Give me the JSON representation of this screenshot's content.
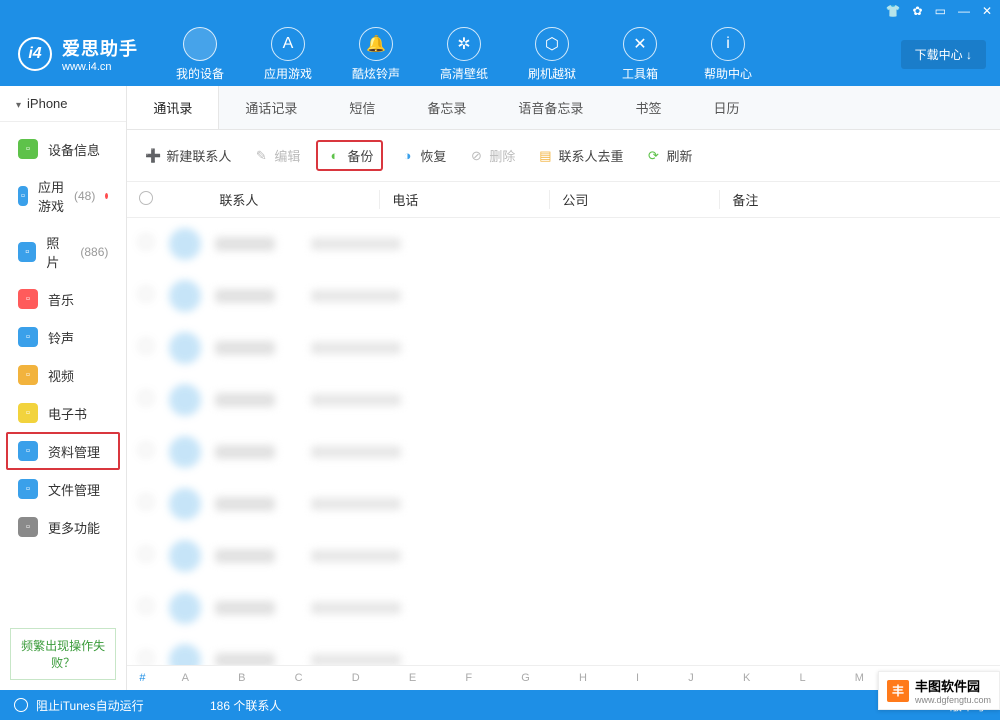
{
  "brand": {
    "cn": "爱思助手",
    "en": "www.i4.cn",
    "logo": "i4"
  },
  "titlebar_icons": [
    "tshirt",
    "gear",
    "skin",
    "minimize",
    "close"
  ],
  "download_center": "下载中心 ↓",
  "top_nav": [
    {
      "label": "我的设备",
      "active": true
    },
    {
      "label": "应用游戏"
    },
    {
      "label": "酷炫铃声"
    },
    {
      "label": "高清壁纸"
    },
    {
      "label": "刷机越狱"
    },
    {
      "label": "工具箱"
    },
    {
      "label": "帮助中心"
    }
  ],
  "device_label": "iPhone",
  "sidebar": [
    {
      "label": "设备信息",
      "color": "#5ec24a"
    },
    {
      "label": "应用游戏",
      "count": "(48)",
      "dot": true,
      "color": "#3aa0ea"
    },
    {
      "label": "照片",
      "count": "(886)",
      "color": "#3aa0ea"
    },
    {
      "label": "音乐",
      "color": "#ff5b5b"
    },
    {
      "label": "铃声",
      "color": "#3aa0ea"
    },
    {
      "label": "视频",
      "color": "#f2b33d"
    },
    {
      "label": "电子书",
      "color": "#f2d33d"
    },
    {
      "label": "资料管理",
      "selected": true,
      "color": "#3aa0ea"
    },
    {
      "label": "文件管理",
      "color": "#3aa0ea"
    },
    {
      "label": "更多功能",
      "color": "#8a8a8a"
    }
  ],
  "side_help": "频繁出现操作失败？",
  "tabs": [
    {
      "label": "通讯录",
      "active": true
    },
    {
      "label": "通话记录"
    },
    {
      "label": "短信"
    },
    {
      "label": "备忘录"
    },
    {
      "label": "语音备忘录"
    },
    {
      "label": "书签"
    },
    {
      "label": "日历"
    }
  ],
  "toolbar": {
    "new_contact": "新建联系人",
    "edit": "编辑",
    "backup": "备份",
    "restore": "恢复",
    "delete": "删除",
    "dedupe": "联系人去重",
    "refresh": "刷新"
  },
  "columns": {
    "contact": "联系人",
    "phone": "电话",
    "company": "公司",
    "remark": "备注"
  },
  "row_count": 9,
  "alpha_index": "# A B C D E F G H I J K L M N O P Q R S T U V W X Y Z",
  "footer": {
    "itunes": "阻止iTunes自动运行",
    "contacts_count": "186 个联系人",
    "version": "版本号"
  },
  "watermark": {
    "logo": "丰",
    "line1": "丰图软件园",
    "line2": "www.dgfengtu.com"
  }
}
